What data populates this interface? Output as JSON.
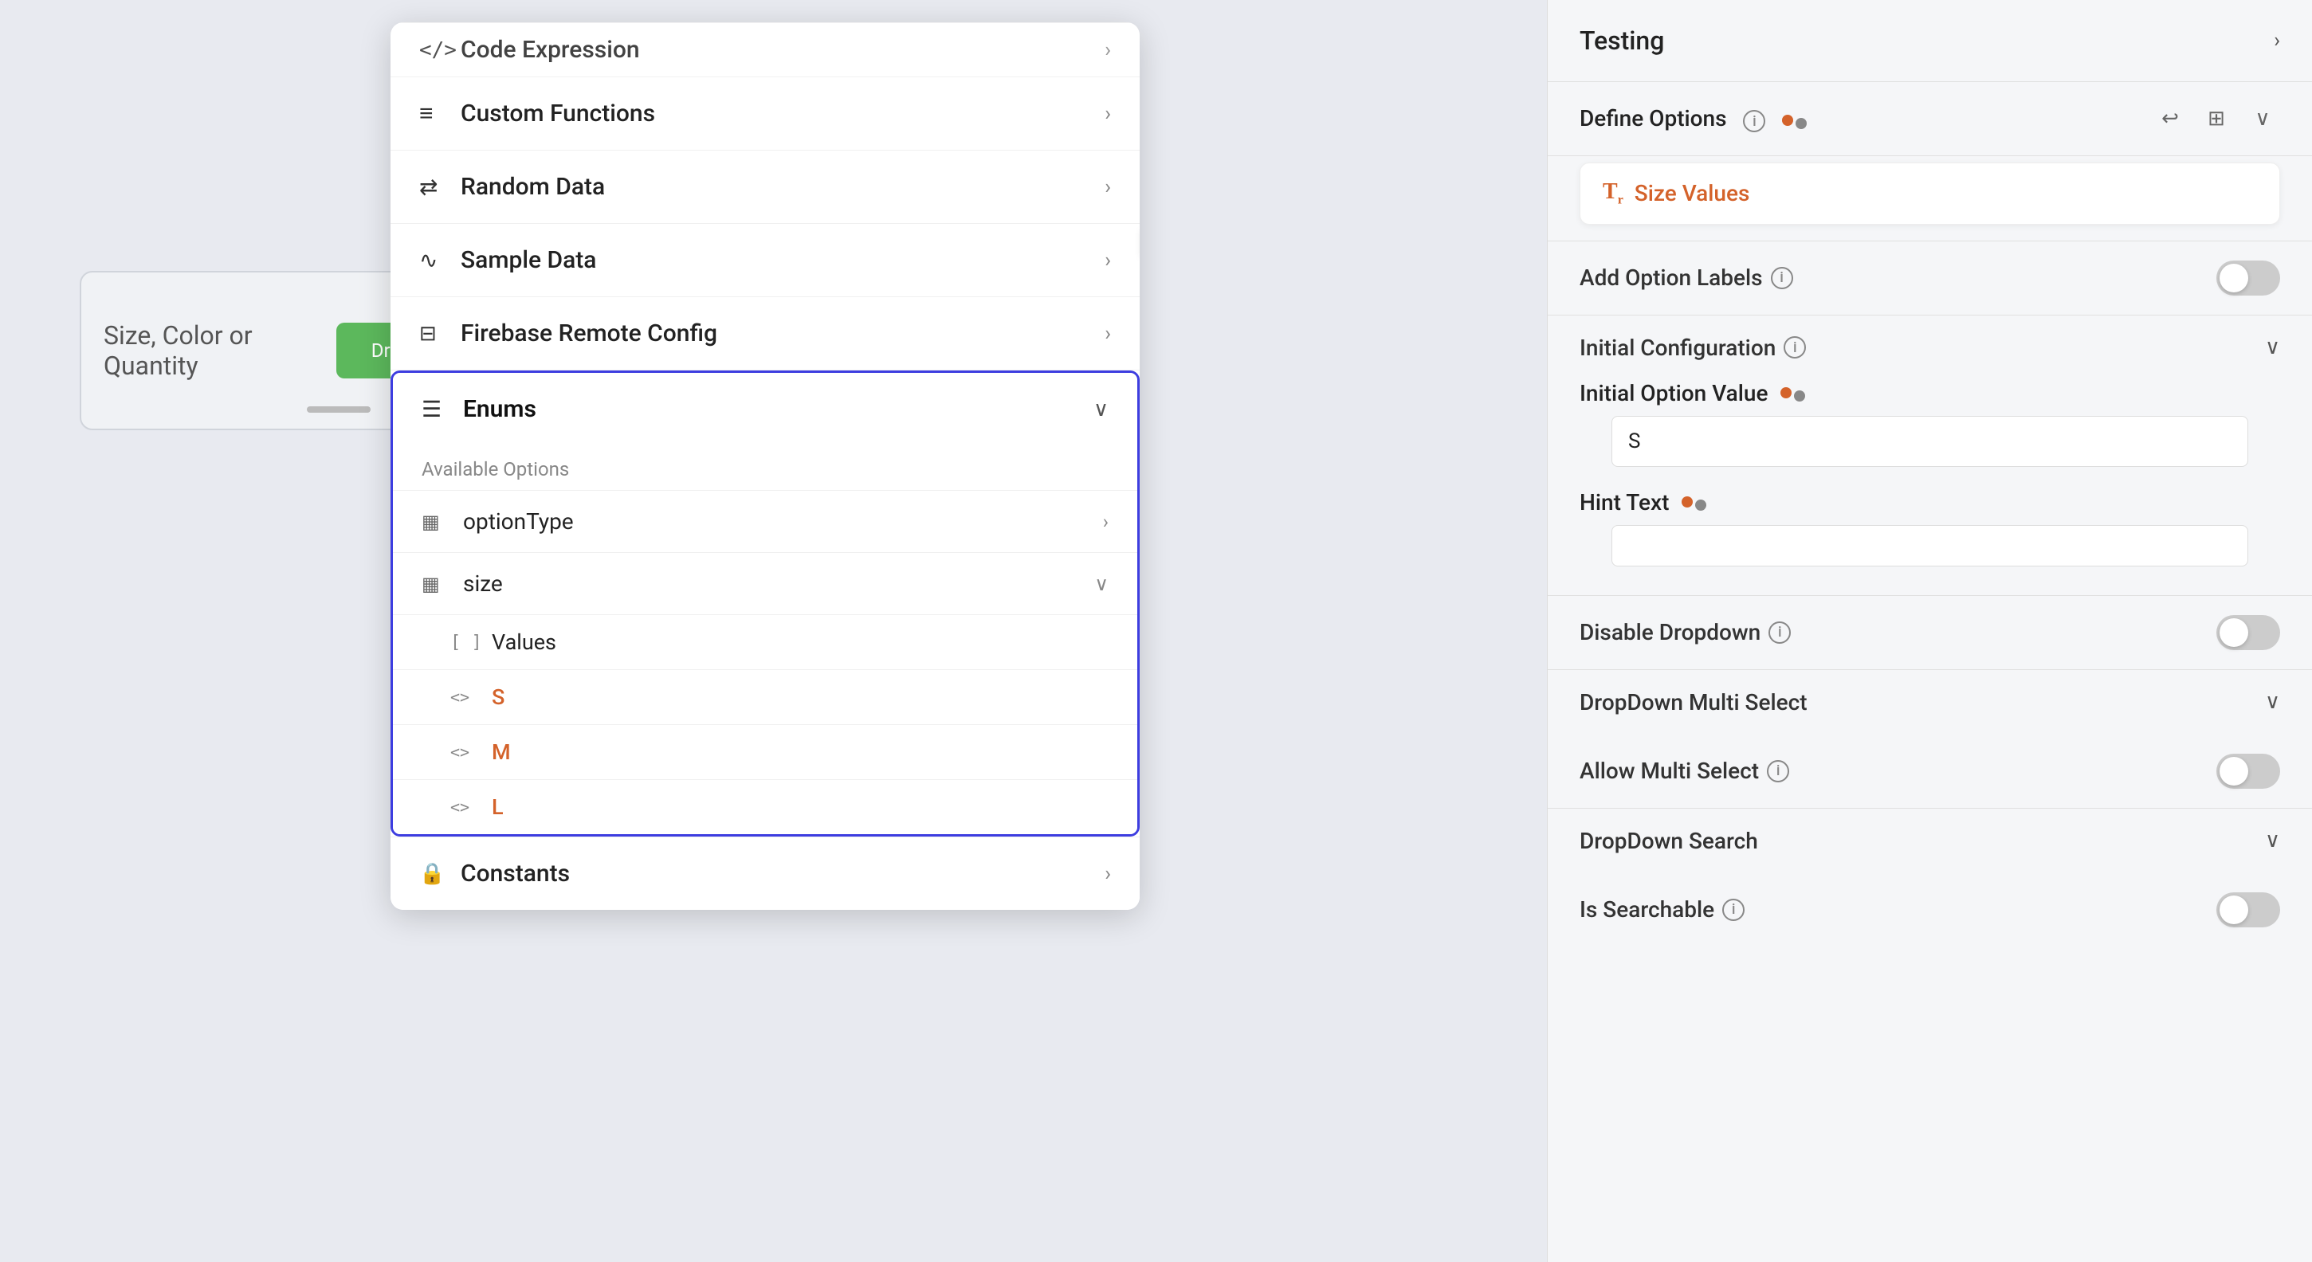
{
  "canvas": {
    "background": "#e8eaf0"
  },
  "widget": {
    "label": "Size, Color or Quantity",
    "dropdown_text": "Drop"
  },
  "dropdown_menu": {
    "top_item": {
      "icon": "⟨/⟩",
      "label": "Code Expression",
      "has_arrow": true
    },
    "items": [
      {
        "icon": "≡",
        "label": "Custom Functions",
        "has_arrow": true,
        "id": "custom-functions"
      },
      {
        "icon": "⇄",
        "label": "Random Data",
        "has_arrow": true,
        "id": "random-data"
      },
      {
        "icon": "≋",
        "label": "Sample Data",
        "has_arrow": true,
        "id": "sample-data"
      },
      {
        "icon": "≍",
        "label": "Firebase Remote Config",
        "has_arrow": true,
        "id": "firebase-remote-config"
      }
    ],
    "enums": {
      "label": "Enums",
      "icon": "☰",
      "available_options_label": "Available Options",
      "sub_items": [
        {
          "icon": "▦",
          "label": "optionType",
          "has_arrow": true,
          "id": "option-type"
        },
        {
          "icon": "▦",
          "label": "size",
          "has_arrow": false,
          "expanded": true,
          "id": "size",
          "children": [
            {
              "icon": "[ ]",
              "label": "Values",
              "id": "values"
            },
            {
              "icon": "<>",
              "label": "S",
              "color": "orange",
              "id": "s-value"
            },
            {
              "icon": "<>",
              "label": "M",
              "color": "orange",
              "id": "m-value"
            },
            {
              "icon": "<>",
              "label": "L",
              "color": "orange",
              "id": "l-value"
            }
          ]
        }
      ]
    },
    "constants": {
      "icon": "🔒",
      "label": "Constants",
      "has_arrow": true,
      "id": "constants"
    }
  },
  "right_panel": {
    "testing": {
      "label": "Testing",
      "arrow": "›"
    },
    "define_options": {
      "label": "Define Options",
      "arrow": "∨",
      "undo_icon": "↩",
      "settings_icon": "⊞"
    },
    "size_values_chip": {
      "icon": "Tr",
      "label": "Size Values"
    },
    "add_option_labels": {
      "label": "Add Option Labels",
      "toggle_active": false
    },
    "initial_configuration": {
      "label": "Initial Configuration",
      "arrow": "∨",
      "initial_option_value": {
        "label": "Initial Option Value",
        "value": "S"
      },
      "hint_text": {
        "label": "Hint Text",
        "value": ""
      }
    },
    "disable_dropdown": {
      "label": "Disable Dropdown",
      "toggle_active": false
    },
    "dropdown_multi_select": {
      "label": "DropDown Multi Select",
      "arrow": "∨"
    },
    "allow_multi_select": {
      "label": "Allow Multi Select",
      "toggle_active": false
    },
    "dropdown_search": {
      "label": "DropDown Search",
      "arrow": "∨"
    },
    "is_searchable": {
      "label": "Is Searchable",
      "toggle_active": false
    }
  }
}
